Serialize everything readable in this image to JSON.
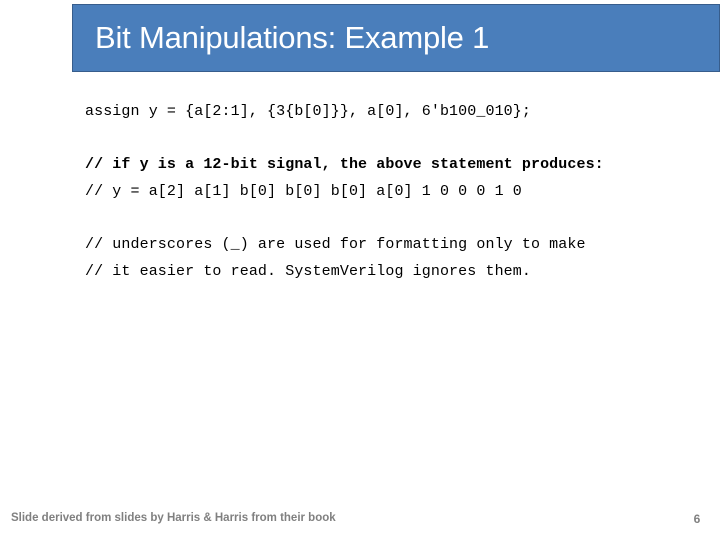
{
  "slide": {
    "title": "Bit Manipulations: Example 1",
    "title_bar_color": "#4a7ebb",
    "title_border_color": "#375d8c",
    "title_text_color": "#ffffff",
    "background_color": "#ffffff",
    "footer_text_color": "#808080"
  },
  "code_blocks": [
    {
      "lines": [
        {
          "text": "assign y = {a[2:1], {3{b[0]}}, a[0], 6'b100_010};",
          "bold": false
        }
      ]
    },
    {
      "lines": [
        {
          "text": "// if y is a 12-bit signal, the above statement produces:",
          "bold": true
        },
        {
          "text": "// y = a[2] a[1] b[0] b[0] b[0] a[0] 1 0 0 0 1 0",
          "bold": false
        }
      ]
    },
    {
      "lines": [
        {
          "text": "// underscores (_) are used for formatting only to make",
          "bold": false
        },
        {
          "text": "// it easier to read. SystemVerilog ignores them.",
          "bold": false
        }
      ]
    }
  ],
  "footer": {
    "note": "Slide derived from slides by Harris & Harris from their book",
    "page_number": "6"
  }
}
